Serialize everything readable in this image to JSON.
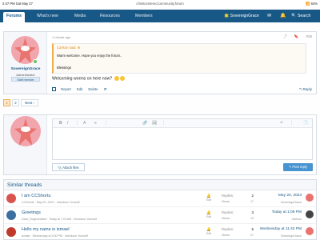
{
  "statusbar": {
    "time": "2:47 PM",
    "date": "Sat May 27",
    "url": "christcentered.community.forum",
    "battery": "64%"
  },
  "nav": {
    "tabs": [
      "Forums",
      "What's new",
      "Media",
      "Resources",
      "Members"
    ],
    "user": "SovereignGrace",
    "search": "Search"
  },
  "post": {
    "meta": "1 minute ago",
    "tools": [
      "share",
      "bookmark",
      "#26"
    ],
    "author": {
      "name": "SovereignGrace",
      "title": "Administrator",
      "banner": "Staff member",
      "online": true
    },
    "quote": {
      "head": "Carlson said: ⊕",
      "line1": "Warm welcome. Hope you enjoy the forum..",
      "line2": "Blessings"
    },
    "body": "Welcoming worms on here now?",
    "actions": [
      "Report",
      "Edit",
      "Delete",
      "IP"
    ],
    "reply": "Reply"
  },
  "pager": {
    "pages": [
      "1",
      "2"
    ],
    "current": "1",
    "next": "Next ›"
  },
  "editor": {
    "toolbar": [
      "B",
      "I",
      "⋮",
      "A",
      "≡",
      "⋮",
      "🔗",
      "🖼",
      "⋮",
      "↶",
      "⋮",
      "📄"
    ],
    "attach": "Attach files",
    "post_reply": "Post reply"
  },
  "similar": {
    "heading": "Similar threads",
    "replies_label": "Replies:",
    "views_label": "Views:",
    "edit_label": "Edit",
    "threads": [
      {
        "title": "I am CCShorts.",
        "sub": "CCShorts · May 20, 2023 · Introduce Yourself",
        "replies": "2",
        "views": "17",
        "date": "May 20, 2023",
        "last_user": "SovereignGrace",
        "av_color": "#d9534f",
        "last_av_color": "#e8736f"
      },
      {
        "title": "Greetings",
        "sub": "Dave_Regenerated · Today at 7:24 AM · Introduce Yourself",
        "replies": "3",
        "views": "13",
        "date": "Today at 1:09 PM",
        "last_user": "Carlson",
        "av_color": "#3b6fa0",
        "last_av_color": "#444444"
      },
      {
        "title": "Hello my name is ismael",
        "sub": "ismale · Wednesday at 3:00 PM · Introduce Yourself",
        "replies": "5",
        "views": "27",
        "date": "Wednesday at 11:42 PM",
        "last_user": "SovereignGrace",
        "av_color": "#c0392b",
        "last_av_color": "#e8736f"
      }
    ]
  },
  "colors": {
    "nav": "#185886",
    "accent": "#f0ad4e",
    "link": "#185886",
    "button": "#4794d1"
  }
}
